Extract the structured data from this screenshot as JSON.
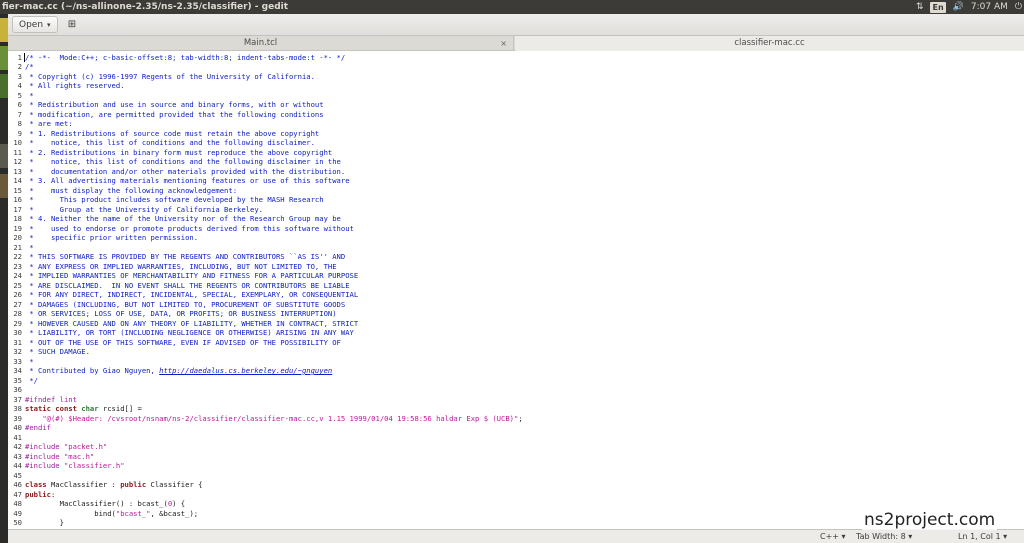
{
  "window": {
    "title": "fier-mac.cc (~/ns-allinone-2.35/ns-2.35/classifier) - gedit"
  },
  "system_tray": {
    "network_glyph": "⇅",
    "keyboard": "En",
    "volume_glyph": "🔊",
    "time": "7:07 AM",
    "user_glyph": "⏻"
  },
  "toolbar": {
    "open_label": "Open",
    "open_caret": "▾",
    "new_icon_glyph": "⊞"
  },
  "tabs": [
    {
      "label": "Main.tcl",
      "close": "×"
    },
    {
      "label": "classifier-mac.cc"
    }
  ],
  "code": [
    [
      {
        "t": "/* -*-  Mode:C++; c-basic-offset:8; tab-width:8; indent-tabs-mode:t -*- */",
        "c": "comment"
      }
    ],
    [
      {
        "t": "/*",
        "c": "comment"
      }
    ],
    [
      {
        "t": " * Copyright (c) 1996-1997 Regents of the University of California.",
        "c": "comment"
      }
    ],
    [
      {
        "t": " * All rights reserved.",
        "c": "comment"
      }
    ],
    [
      {
        "t": " *",
        "c": "comment"
      }
    ],
    [
      {
        "t": " * Redistribution and use in source and binary forms, with or without",
        "c": "comment"
      }
    ],
    [
      {
        "t": " * modification, are permitted provided that the following conditions",
        "c": "comment"
      }
    ],
    [
      {
        "t": " * are met:",
        "c": "comment"
      }
    ],
    [
      {
        "t": " * 1. Redistributions of source code must retain the above copyright",
        "c": "comment"
      }
    ],
    [
      {
        "t": " *    notice, this list of conditions and the following disclaimer.",
        "c": "comment"
      }
    ],
    [
      {
        "t": " * 2. Redistributions in binary form must reproduce the above copyright",
        "c": "comment"
      }
    ],
    [
      {
        "t": " *    notice, this list of conditions and the following disclaimer in the",
        "c": "comment"
      }
    ],
    [
      {
        "t": " *    documentation and/or other materials provided with the distribution.",
        "c": "comment"
      }
    ],
    [
      {
        "t": " * 3. All advertising materials mentioning features or use of this software",
        "c": "comment"
      }
    ],
    [
      {
        "t": " *    must display the following acknowledgement:",
        "c": "comment"
      }
    ],
    [
      {
        "t": " *      This product includes software developed by the MASH Research",
        "c": "comment"
      }
    ],
    [
      {
        "t": " *      Group at the University of California Berkeley.",
        "c": "comment"
      }
    ],
    [
      {
        "t": " * 4. Neither the name of the University nor of the Research Group may be",
        "c": "comment"
      }
    ],
    [
      {
        "t": " *    used to endorse or promote products derived from this software without",
        "c": "comment"
      }
    ],
    [
      {
        "t": " *    specific prior written permission.",
        "c": "comment"
      }
    ],
    [
      {
        "t": " *",
        "c": "comment"
      }
    ],
    [
      {
        "t": " * THIS SOFTWARE IS PROVIDED BY THE REGENTS AND CONTRIBUTORS ``AS IS'' AND",
        "c": "comment"
      }
    ],
    [
      {
        "t": " * ANY EXPRESS OR IMPLIED WARRANTIES, INCLUDING, BUT NOT LIMITED TO, THE",
        "c": "comment"
      }
    ],
    [
      {
        "t": " * IMPLIED WARRANTIES OF MERCHANTABILITY AND FITNESS FOR A PARTICULAR PURPOSE",
        "c": "comment"
      }
    ],
    [
      {
        "t": " * ARE DISCLAIMED.  IN NO EVENT SHALL THE REGENTS OR CONTRIBUTORS BE LIABLE",
        "c": "comment"
      }
    ],
    [
      {
        "t": " * FOR ANY DIRECT, INDIRECT, INCIDENTAL, SPECIAL, EXEMPLARY, OR CONSEQUENTIAL",
        "c": "comment"
      }
    ],
    [
      {
        "t": " * DAMAGES (INCLUDING, BUT NOT LIMITED TO, PROCUREMENT OF SUBSTITUTE GOODS",
        "c": "comment"
      }
    ],
    [
      {
        "t": " * OR SERVICES; LOSS OF USE, DATA, OR PROFITS; OR BUSINESS INTERRUPTION)",
        "c": "comment"
      }
    ],
    [
      {
        "t": " * HOWEVER CAUSED AND ON ANY THEORY OF LIABILITY, WHETHER IN CONTRACT, STRICT",
        "c": "comment"
      }
    ],
    [
      {
        "t": " * LIABILITY, OR TORT (INCLUDING NEGLIGENCE OR OTHERWISE) ARISING IN ANY WAY",
        "c": "comment"
      }
    ],
    [
      {
        "t": " * OUT OF THE USE OF THIS SOFTWARE, EVEN IF ADVISED OF THE POSSIBILITY OF",
        "c": "comment"
      }
    ],
    [
      {
        "t": " * SUCH DAMAGE.",
        "c": "comment"
      }
    ],
    [
      {
        "t": " *",
        "c": "comment"
      }
    ],
    [
      {
        "t": " * Contributed by Giao Nguyen, ",
        "c": "comment"
      },
      {
        "t": "http://daedalus.cs.berkeley.edu/~gnguyen",
        "c": "comment url"
      }
    ],
    [
      {
        "t": " */",
        "c": "comment"
      }
    ],
    [],
    [
      {
        "t": "#ifndef lint",
        "c": "pre"
      }
    ],
    [
      {
        "t": "static",
        "c": "kw"
      },
      {
        "t": " "
      },
      {
        "t": "const",
        "c": "kw"
      },
      {
        "t": " "
      },
      {
        "t": "char",
        "c": "type"
      },
      {
        "t": " rcsid[] ="
      }
    ],
    [
      {
        "t": "    "
      },
      {
        "t": "\"@(#) $Header: /cvsroot/nsnam/ns-2/classifier/classifier-mac.cc,v 1.15 1999/01/04 19:58:56 haldar Exp $ (UCB)\"",
        "c": "str"
      },
      {
        "t": ";"
      }
    ],
    [
      {
        "t": "#endif",
        "c": "pre"
      }
    ],
    [],
    [
      {
        "t": "#include ",
        "c": "pre"
      },
      {
        "t": "\"packet.h\"",
        "c": "str"
      }
    ],
    [
      {
        "t": "#include ",
        "c": "pre"
      },
      {
        "t": "\"mac.h\"",
        "c": "str"
      }
    ],
    [
      {
        "t": "#include ",
        "c": "pre"
      },
      {
        "t": "\"classifier.h\"",
        "c": "str"
      }
    ],
    [],
    [
      {
        "t": "class",
        "c": "kw"
      },
      {
        "t": " MacClassifier : "
      },
      {
        "t": "public",
        "c": "kw"
      },
      {
        "t": " Classifier {"
      }
    ],
    [
      {
        "t": "public",
        "c": "kw"
      },
      {
        "t": ":"
      }
    ],
    [
      {
        "t": "        MacClassifier() : bcast_("
      },
      {
        "t": "0",
        "c": "num"
      },
      {
        "t": ") {"
      }
    ],
    [
      {
        "t": "                bind("
      },
      {
        "t": "\"bcast_\"",
        "c": "str"
      },
      {
        "t": ", &bcast_);"
      }
    ],
    [
      {
        "t": "        }"
      }
    ]
  ],
  "status": {
    "language": "C++ ▾",
    "tab_width": "Tab Width: 8 ▾",
    "position": "Ln 1, Col 1 ▾"
  },
  "watermark": "ns2project.com",
  "colors": {
    "comment": "#1020c8",
    "preprocessor": "#a020a0",
    "keyword": "#8b1a1a",
    "type": "#2e7d32",
    "string": "#c0179a"
  }
}
